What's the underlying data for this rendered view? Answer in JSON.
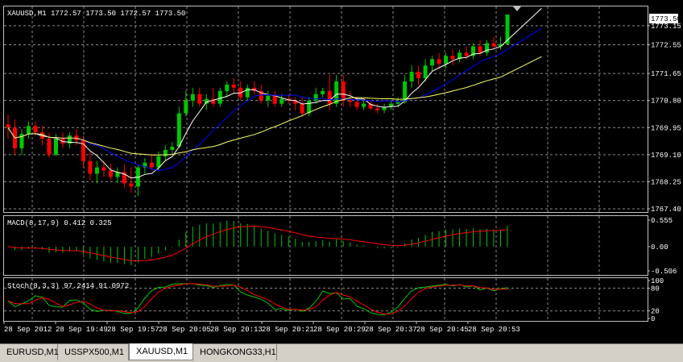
{
  "main_chart": {
    "header": "XAUUSD,M1  1772.57 1773.50 1772.57 1773.50",
    "current_price": "1773.50",
    "price_labels": [
      "1773.15",
      "1772.55",
      "1771.65",
      "1770.80",
      "1769.95",
      "1769.10",
      "1768.25",
      "1767.40"
    ],
    "price_min": 1767.4,
    "price_max": 1773.5
  },
  "macd": {
    "label": "MACD(8,17,9) 0.412 0.325",
    "axis_labels": [
      "0.555",
      "0.00",
      "-0.506"
    ],
    "min": -0.506,
    "max": 0.555
  },
  "stoch": {
    "label": "Stoch(8,3,3) 97.2414 91.0972",
    "axis_labels": [
      "100",
      "80",
      "20",
      "0"
    ]
  },
  "time_labels": [
    "28 Sep 2012",
    "28 Sep 19:49",
    "28 Sep 19:57",
    "28 Sep 20:05",
    "28 Sep 20:13",
    "28 Sep 20:21",
    "28 Sep 20:29",
    "28 Sep 20:37",
    "28 Sep 20:45",
    "28 Sep 20:53"
  ],
  "tabs": [
    {
      "label": "EURUSD,M1",
      "active": false
    },
    {
      "label": "USSPX500,M1",
      "active": false
    },
    {
      "label": "XAUUSD,M1",
      "active": true
    },
    {
      "label": "HONGKONG33,H1",
      "active": false
    }
  ],
  "colors": {
    "background": "#000000",
    "grid": "#8a8a8a",
    "bull": "#00c800",
    "bear": "#ff0000",
    "ma_white": "#ffffff",
    "ma_blue": "#0000ff",
    "ma_yellow": "#ffff66",
    "macd_hist": "#00c800",
    "macd_signal": "#ff0000",
    "stoch_main": "#00c800",
    "stoch_signal": "#ff0000"
  },
  "chart_data": {
    "type": "candlestick",
    "series": [
      {
        "name": "XAUUSD,M1",
        "ohlc": [
          [
            1770.05,
            1770.35,
            1769.6,
            1769.95
          ],
          [
            1769.95,
            1770.2,
            1769.1,
            1769.3
          ],
          [
            1769.3,
            1769.9,
            1769.1,
            1769.75
          ],
          [
            1769.75,
            1770.15,
            1769.6,
            1770.0
          ],
          [
            1770.0,
            1770.15,
            1769.7,
            1769.8
          ],
          [
            1769.8,
            1770.0,
            1769.4,
            1769.6
          ],
          [
            1769.6,
            1769.8,
            1769.0,
            1769.1
          ],
          [
            1769.1,
            1769.75,
            1769.05,
            1769.6
          ],
          [
            1769.6,
            1769.8,
            1769.3,
            1769.45
          ],
          [
            1769.45,
            1769.8,
            1769.3,
            1769.7
          ],
          [
            1769.7,
            1769.9,
            1769.4,
            1769.55
          ],
          [
            1769.55,
            1769.7,
            1768.7,
            1768.9
          ],
          [
            1768.9,
            1769.2,
            1768.3,
            1768.5
          ],
          [
            1768.5,
            1768.9,
            1768.2,
            1768.7
          ],
          [
            1768.7,
            1768.9,
            1768.4,
            1768.6
          ],
          [
            1768.6,
            1768.8,
            1768.3,
            1768.4
          ],
          [
            1768.4,
            1768.7,
            1768.2,
            1768.55
          ],
          [
            1768.55,
            1768.8,
            1768.05,
            1768.2
          ],
          [
            1768.2,
            1768.7,
            1767.9,
            1768.1
          ],
          [
            1768.1,
            1768.8,
            1767.8,
            1768.7
          ],
          [
            1768.7,
            1769.0,
            1768.5,
            1768.85
          ],
          [
            1768.85,
            1769.1,
            1768.6,
            1768.7
          ],
          [
            1768.7,
            1769.2,
            1768.6,
            1769.05
          ],
          [
            1769.05,
            1769.4,
            1768.9,
            1769.25
          ],
          [
            1769.25,
            1769.5,
            1769.1,
            1769.35
          ],
          [
            1769.35,
            1770.6,
            1769.3,
            1770.4
          ],
          [
            1770.4,
            1771.1,
            1770.3,
            1770.8
          ],
          [
            1770.8,
            1771.2,
            1770.6,
            1771.0
          ],
          [
            1771.0,
            1771.2,
            1770.6,
            1770.7
          ],
          [
            1770.7,
            1771.0,
            1770.5,
            1770.85
          ],
          [
            1770.85,
            1771.2,
            1770.6,
            1770.7
          ],
          [
            1770.7,
            1771.2,
            1770.6,
            1771.1
          ],
          [
            1771.1,
            1771.4,
            1770.9,
            1771.3
          ],
          [
            1771.3,
            1771.5,
            1771.0,
            1771.2
          ],
          [
            1771.2,
            1771.4,
            1770.8,
            1770.9
          ],
          [
            1770.9,
            1771.3,
            1770.8,
            1771.2
          ],
          [
            1771.2,
            1771.4,
            1771.0,
            1771.1
          ],
          [
            1771.1,
            1771.3,
            1770.7,
            1770.8
          ],
          [
            1770.8,
            1771.1,
            1770.6,
            1770.95
          ],
          [
            1770.95,
            1771.1,
            1770.6,
            1770.7
          ],
          [
            1770.7,
            1771.0,
            1770.6,
            1770.85
          ],
          [
            1770.85,
            1771.0,
            1770.7,
            1770.8
          ],
          [
            1770.8,
            1770.9,
            1770.5,
            1770.7
          ],
          [
            1770.7,
            1770.9,
            1770.3,
            1770.4
          ],
          [
            1770.4,
            1770.9,
            1770.3,
            1770.8
          ],
          [
            1770.8,
            1771.2,
            1770.7,
            1771.0
          ],
          [
            1771.0,
            1771.2,
            1770.9,
            1771.1
          ],
          [
            1771.1,
            1771.6,
            1770.5,
            1770.7
          ],
          [
            1770.7,
            1771.6,
            1770.6,
            1771.4
          ],
          [
            1771.4,
            1771.6,
            1770.6,
            1770.8
          ],
          [
            1770.8,
            1771.1,
            1770.6,
            1770.75
          ],
          [
            1770.75,
            1770.9,
            1770.5,
            1770.6
          ],
          [
            1770.6,
            1770.8,
            1770.5,
            1770.7
          ],
          [
            1770.7,
            1770.8,
            1770.5,
            1770.55
          ],
          [
            1770.55,
            1770.7,
            1770.4,
            1770.5
          ],
          [
            1770.5,
            1770.7,
            1770.4,
            1770.6
          ],
          [
            1770.6,
            1770.8,
            1770.5,
            1770.7
          ],
          [
            1770.7,
            1770.9,
            1770.6,
            1770.75
          ],
          [
            1770.75,
            1771.6,
            1770.7,
            1771.4
          ],
          [
            1771.4,
            1771.9,
            1771.2,
            1771.7
          ],
          [
            1771.7,
            1771.9,
            1771.3,
            1771.5
          ],
          [
            1771.5,
            1772.1,
            1771.4,
            1771.9
          ],
          [
            1771.9,
            1772.2,
            1771.7,
            1772.1
          ],
          [
            1772.1,
            1772.3,
            1771.8,
            1771.95
          ],
          [
            1771.95,
            1772.3,
            1771.8,
            1772.2
          ],
          [
            1772.2,
            1772.4,
            1771.9,
            1772.1
          ],
          [
            1772.1,
            1772.4,
            1772.0,
            1772.3
          ],
          [
            1772.3,
            1772.5,
            1772.1,
            1772.2
          ],
          [
            1772.2,
            1772.6,
            1772.1,
            1772.5
          ],
          [
            1772.5,
            1772.7,
            1772.2,
            1772.3
          ],
          [
            1772.3,
            1772.7,
            1772.2,
            1772.6
          ],
          [
            1772.6,
            1772.8,
            1772.4,
            1772.5
          ],
          [
            1772.5,
            1772.8,
            1772.4,
            1772.57
          ],
          [
            1772.57,
            1773.5,
            1772.57,
            1773.5
          ]
        ]
      }
    ],
    "ylim": [
      1767.4,
      1773.5
    ]
  }
}
